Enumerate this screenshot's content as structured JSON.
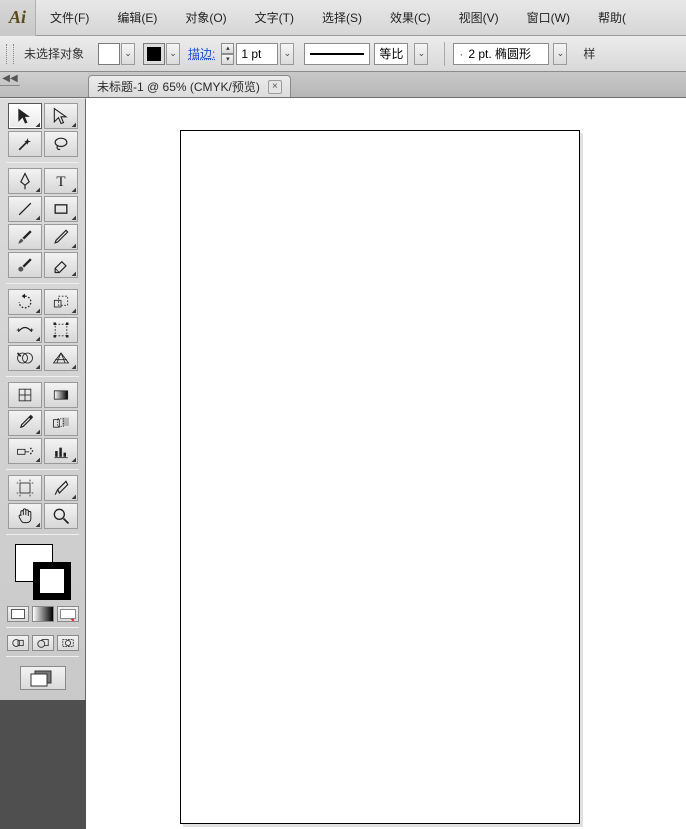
{
  "app": {
    "short": "Ai"
  },
  "menu": {
    "file": "文件(F)",
    "edit": "编辑(E)",
    "object": "对象(O)",
    "type": "文字(T)",
    "select": "选择(S)",
    "effect": "效果(C)",
    "view": "视图(V)",
    "window": "窗口(W)",
    "help": "帮助("
  },
  "control": {
    "selection_status": "未选择对象",
    "stroke_label": "描边:",
    "stroke_weight": "1 pt",
    "profile_label": "等比",
    "brush_text": "2 pt. 椭圆形",
    "trailing": "样"
  },
  "tab": {
    "title": "未标题-1  @  65% (CMYK/预览)",
    "close": "×"
  },
  "icons": {
    "dd": "⌄",
    "up": "▴",
    "down": "▾",
    "dot": "·"
  }
}
